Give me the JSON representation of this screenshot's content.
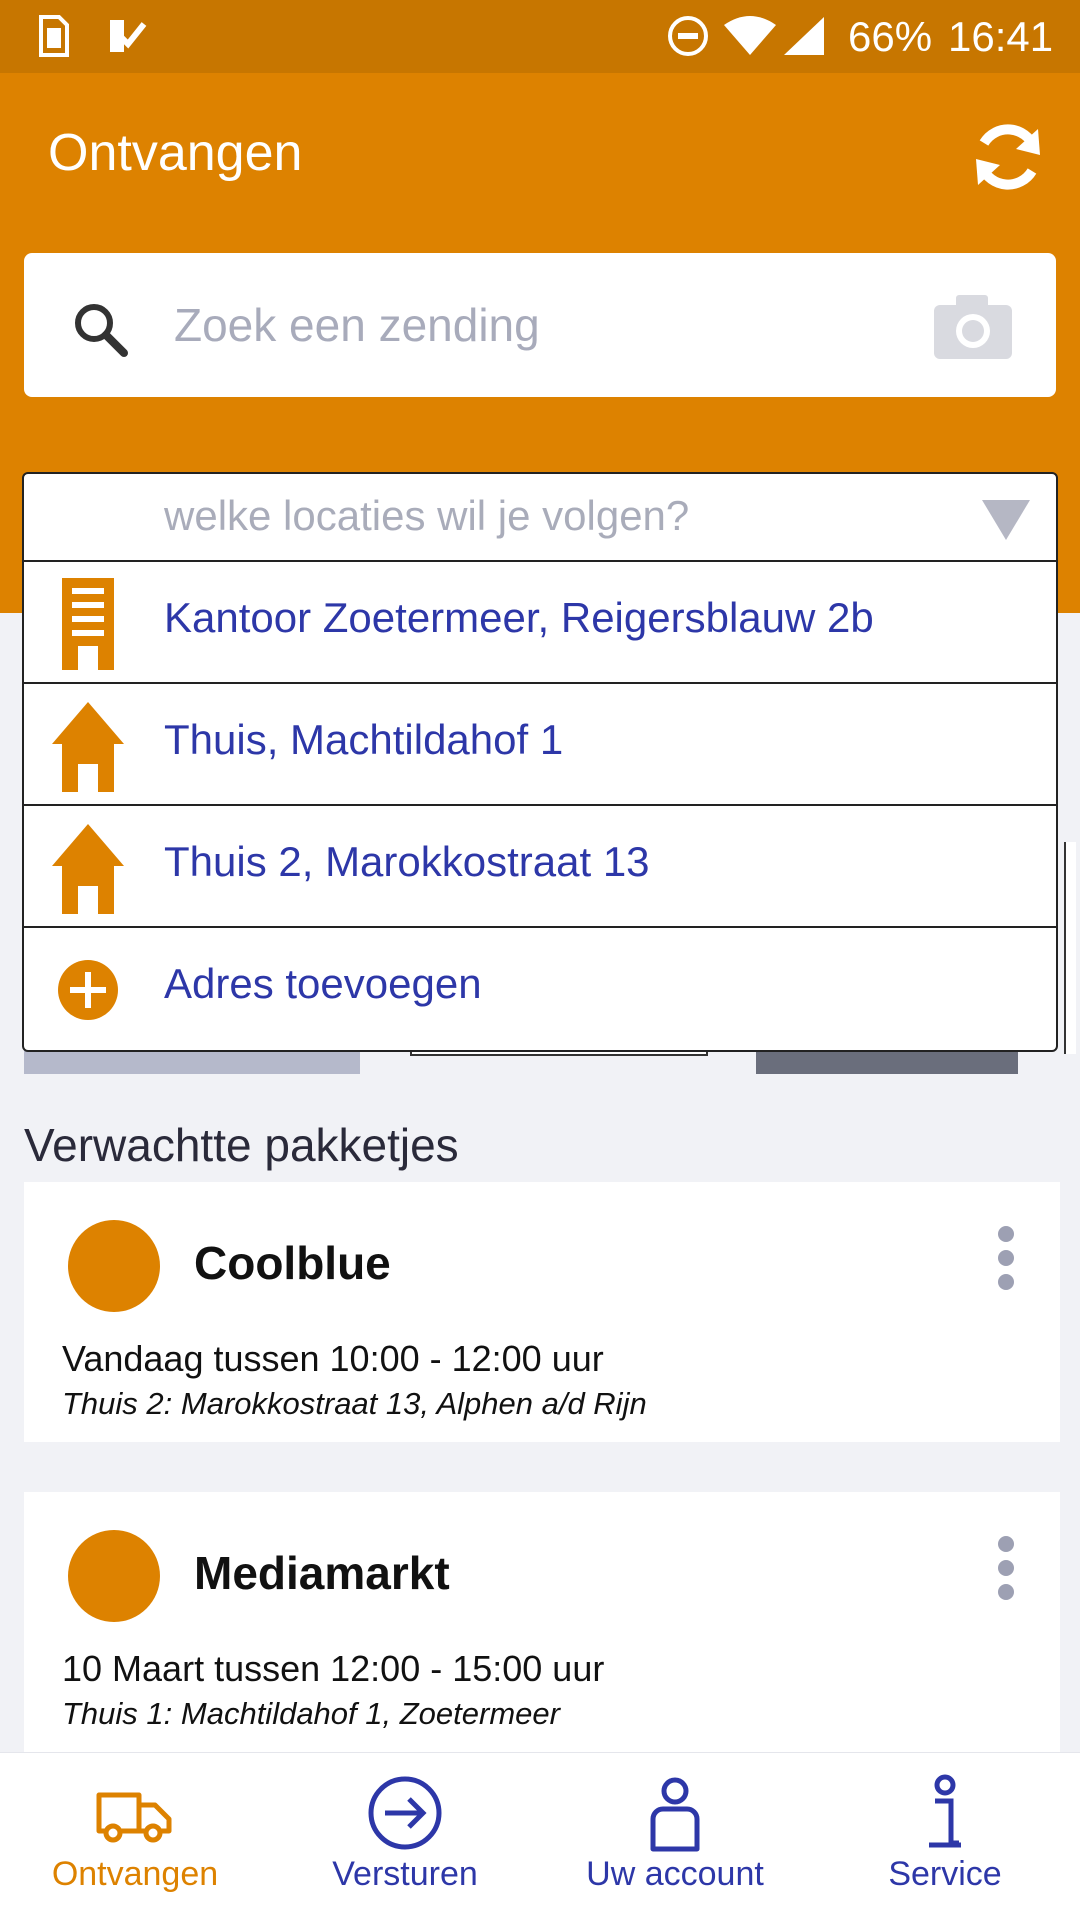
{
  "status_bar": {
    "battery": "66%",
    "time": "16:41",
    "icons": [
      "sim-icon",
      "check-icon",
      "dnd-icon",
      "wifi-icon",
      "signal-icon"
    ]
  },
  "header": {
    "title": "Ontvangen",
    "refresh_icon": "refresh-icon"
  },
  "search": {
    "placeholder": "Zoek een zending",
    "search_icon": "search-icon",
    "camera_icon": "camera-icon"
  },
  "location_dropdown": {
    "prompt": "welke locaties wil je volgen?",
    "items": [
      {
        "icon": "office-building-icon",
        "label": "Kantoor Zoetermeer, Reigersblauw 2b"
      },
      {
        "icon": "house-icon",
        "label": "Thuis, Machtildahof 1"
      },
      {
        "icon": "house-icon",
        "label": "Thuis 2, Marokkostraat 13"
      },
      {
        "icon": "add-circle-icon",
        "label": "Adres toevoegen"
      }
    ]
  },
  "expected": {
    "section_title": "Verwachtte pakketjes",
    "cards": [
      {
        "title": "Coolblue",
        "time": "Vandaag tussen 10:00 - 12:00 uur",
        "address": "Thuis 2: Marokkostraat 13, Alphen a/d Rijn"
      },
      {
        "title": "Mediamarkt",
        "time": "10 Maart tussen 12:00 - 15:00 uur",
        "address": "Thuis 1: Machtildahof 1, Zoetermeer"
      }
    ]
  },
  "bottom_nav": {
    "items": [
      {
        "label": "Ontvangen",
        "icon": "delivery-van-icon",
        "active": true
      },
      {
        "label": "Versturen",
        "icon": "send-arrow-icon",
        "active": false
      },
      {
        "label": "Uw account",
        "icon": "person-icon",
        "active": false
      },
      {
        "label": "Service",
        "icon": "info-icon",
        "active": false
      }
    ]
  },
  "colors": {
    "brand_orange": "#dd8200",
    "status_bar": "#c77600",
    "link_blue": "#2d37a8",
    "background": "#f1f2f6"
  }
}
